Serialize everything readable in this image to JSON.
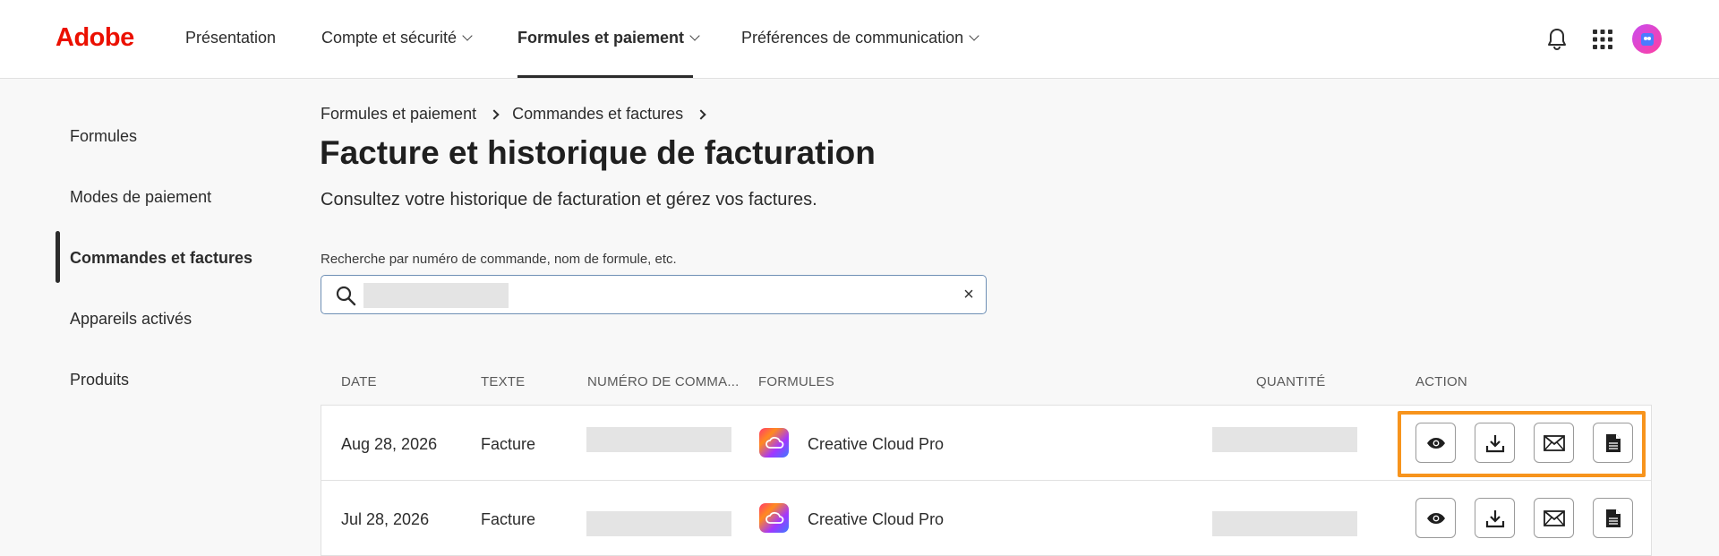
{
  "brand": {
    "logo_text": "Adobe",
    "logo_color": "#eb1000"
  },
  "nav": {
    "items": [
      {
        "label": "Présentation",
        "has_dropdown": false,
        "active": false
      },
      {
        "label": "Compte et sécurité",
        "has_dropdown": true,
        "active": false
      },
      {
        "label": "Formules et paiement",
        "has_dropdown": true,
        "active": true
      },
      {
        "label": "Préférences de communication",
        "has_dropdown": true,
        "active": false
      }
    ],
    "icons": [
      "bell-icon",
      "apps-grid-icon",
      "avatar"
    ]
  },
  "sidebar": {
    "items": [
      {
        "label": "Formules",
        "active": false
      },
      {
        "label": "Modes de paiement",
        "active": false
      },
      {
        "label": "Commandes et factures",
        "active": true
      },
      {
        "label": "Appareils activés",
        "active": false
      },
      {
        "label": "Produits",
        "active": false
      }
    ]
  },
  "breadcrumb": [
    "Formules et paiement",
    "Commandes et factures"
  ],
  "page": {
    "title": "Facture et historique de facturation",
    "subtitle": "Consultez votre historique de facturation et gérez vos factures."
  },
  "search": {
    "label": "Recherche par numéro de commande, nom de formule, etc.",
    "value": "",
    "clear_symbol": "×"
  },
  "table": {
    "headers": [
      "DATE",
      "TEXTE",
      "NUMÉRO DE COMMA...",
      "FORMULES",
      "QUANTITÉ",
      "ACTION"
    ],
    "rows": [
      {
        "date": "Aug 28, 2026",
        "text": "Facture",
        "order_number": "",
        "plan": "Creative Cloud Pro",
        "quantity": ""
      },
      {
        "date": "Jul 28, 2026",
        "text": "Facture",
        "order_number": "",
        "plan": "Creative Cloud Pro",
        "quantity": ""
      }
    ],
    "actions": [
      "view-icon",
      "download-icon",
      "email-icon",
      "document-icon"
    ]
  },
  "colors": {
    "highlight": "#f7941d",
    "accent_text": "#2c2c2c",
    "search_border": "#6e8fb5"
  }
}
